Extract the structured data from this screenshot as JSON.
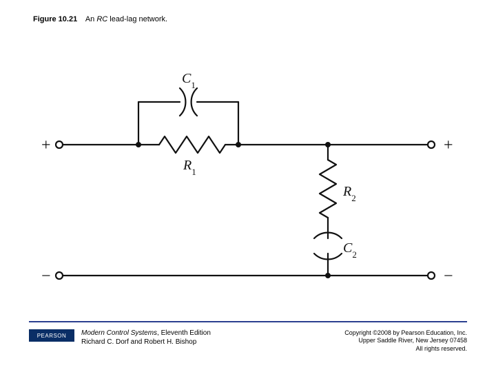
{
  "caption": {
    "figure_number": "Figure 10.21",
    "desc_prefix": "An ",
    "desc_emph": "RC",
    "desc_suffix": " lead-lag network."
  },
  "components": {
    "C1": "C",
    "C1_sub": "1",
    "R1": "R",
    "R1_sub": "1",
    "R2": "R",
    "R2_sub": "2",
    "C2": "C",
    "C2_sub": "2"
  },
  "terminals": {
    "in_plus": "+",
    "in_minus": "−",
    "out_plus": "+",
    "out_minus": "−"
  },
  "footer": {
    "pearson": "PEARSON",
    "book_title": "Modern Control Systems",
    "book_edition": ", Eleventh Edition",
    "book_authors": "Richard C. Dorf and Robert H. Bishop",
    "copyright_line1": "Copyright ©2008 by Pearson Education, Inc.",
    "copyright_line2": "Upper Saddle River, New Jersey 07458",
    "copyright_line3": "All rights reserved."
  }
}
